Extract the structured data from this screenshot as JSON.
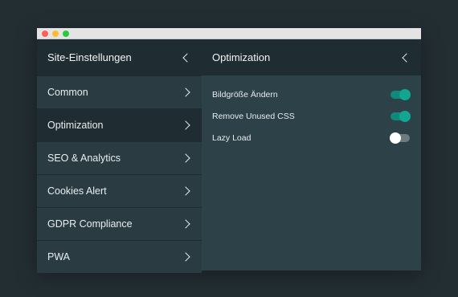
{
  "sidebar": {
    "title": "Site-Einstellungen",
    "items": [
      {
        "label": "Common",
        "active": false
      },
      {
        "label": "Optimization",
        "active": true
      },
      {
        "label": "SEO & Analytics",
        "active": false
      },
      {
        "label": "Cookies Alert",
        "active": false
      },
      {
        "label": "GDPR Compliance",
        "active": false
      },
      {
        "label": "PWA",
        "active": false
      }
    ]
  },
  "main": {
    "title": "Optimization",
    "settings": [
      {
        "label": "Bildgröße Ändern",
        "enabled": true
      },
      {
        "label": "Remove Unused CSS",
        "enabled": true
      },
      {
        "label": "Lazy Load",
        "enabled": false
      }
    ]
  },
  "colors": {
    "accent": "#12a58f",
    "background": "#232e33",
    "sidebar": "#2a3b42"
  },
  "icons": {
    "back": "chevron-left-icon",
    "forward": "chevron-right-icon"
  }
}
